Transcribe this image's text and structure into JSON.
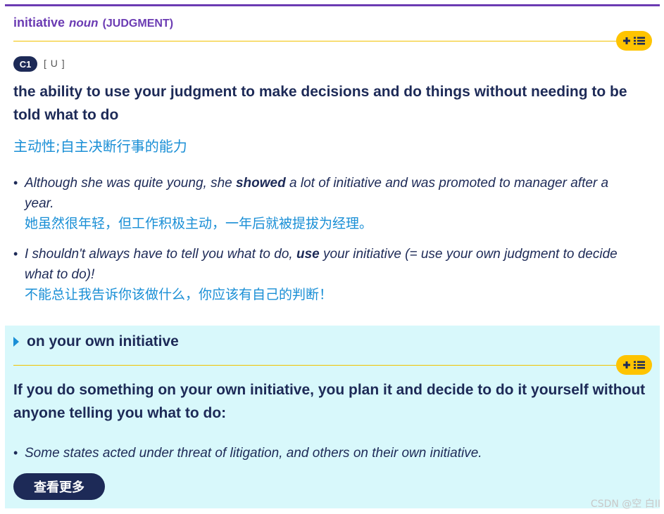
{
  "entry": {
    "headword": "initiative",
    "pos": "noun",
    "guideword": "(JUDGMENT)",
    "level": "C1",
    "grammar": "[ U ]",
    "definition": "the ability to use your judgment to make decisions and do things without needing to be told what to do",
    "translation": "主动性;自主决断行事的能力",
    "examples": [
      {
        "pre": "Although she was quite young, she ",
        "bold": "showed",
        "post": " a lot of initiative and was promoted to manager after a year.",
        "zh": "她虽然很年轻，但工作积极主动，一年后就被提拔为经理。"
      },
      {
        "pre": "I shouldn't always have to tell you what to do, ",
        "bold": "use",
        "post": " your initiative (= use your own judgment to decide what to do)!",
        "zh": "不能总让我告诉你该做什么，你应该有自己的判断！"
      }
    ]
  },
  "idiom": {
    "phrase": "on your own initiative",
    "definition": "If you do something on your own initiative, you plan it and decide to do it yourself without anyone telling you what to do:",
    "example": "Some states acted under threat of litigation, and others on their own initiative."
  },
  "buttons": {
    "more_label": "查看更多",
    "add_to_list_icon": "plus-list-icon"
  },
  "watermark": "CSDN @空 白II",
  "colors": {
    "purple": "#6b3bb3",
    "navy": "#1d2a57",
    "blue": "#1a8fd6",
    "yellow": "#fec400",
    "panel": "#d8f8fb"
  }
}
